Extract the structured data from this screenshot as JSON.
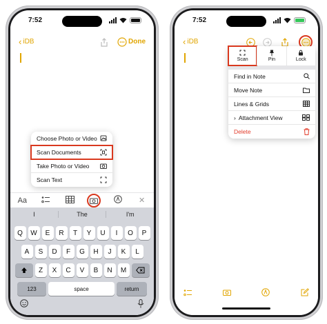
{
  "left_phone": {
    "status": {
      "time": "7:52"
    },
    "nav": {
      "back_label": "iDB",
      "done_label": "Done"
    },
    "camera_menu": {
      "items": [
        {
          "label": "Choose Photo or Video",
          "icon": "photo-icon"
        },
        {
          "label": "Scan Documents",
          "icon": "scan-document-icon",
          "highlighted": true
        },
        {
          "label": "Take Photo or Video",
          "icon": "camera-icon"
        },
        {
          "label": "Scan Text",
          "icon": "scan-text-icon"
        }
      ]
    },
    "toolbar": {
      "format_label": "Aa",
      "close_label": "✕"
    },
    "keyboard": {
      "suggestions": [
        "I",
        "The",
        "I'm"
      ],
      "row1": [
        "Q",
        "W",
        "E",
        "R",
        "T",
        "Y",
        "U",
        "I",
        "O",
        "P"
      ],
      "row2": [
        "A",
        "S",
        "D",
        "F",
        "G",
        "H",
        "J",
        "K",
        "L"
      ],
      "row3": [
        "Z",
        "X",
        "C",
        "V",
        "B",
        "N",
        "M"
      ],
      "numbers_label": "123",
      "space_label": "space",
      "return_label": "return"
    }
  },
  "right_phone": {
    "status": {
      "time": "7:52"
    },
    "nav": {
      "back_label": "iDB"
    },
    "more_menu": {
      "segments": [
        {
          "label": "Scan",
          "icon": "scan-icon",
          "highlighted": true
        },
        {
          "label": "Pin",
          "icon": "pin-icon"
        },
        {
          "label": "Lock",
          "icon": "lock-icon"
        }
      ],
      "items": [
        {
          "label": "Find in Note",
          "icon": "search-icon"
        },
        {
          "label": "Move Note",
          "icon": "folder-icon"
        },
        {
          "label": "Lines & Grids",
          "icon": "grid-icon"
        },
        {
          "label": "Attachment View",
          "icon": "attachment-view-icon",
          "prefix": "›"
        },
        {
          "label": "Delete",
          "icon": "trash-icon",
          "destructive": true
        }
      ]
    }
  },
  "colors": {
    "accent": "#e1a500",
    "highlight": "#d9381e",
    "delete": "#e23b2a"
  }
}
